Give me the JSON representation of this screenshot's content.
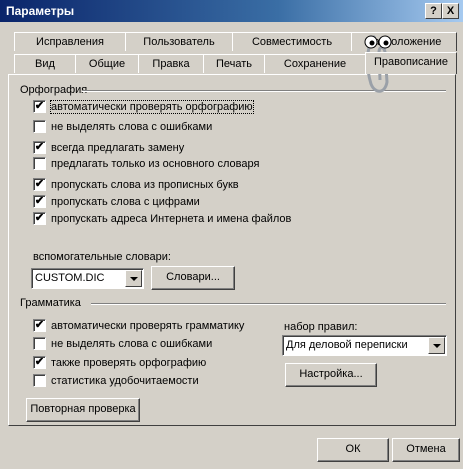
{
  "window": {
    "title": "Параметры",
    "help_label": "?",
    "close_label": "X"
  },
  "tabs_back": [
    "Исправления",
    "Пользователь",
    "Совместимость",
    "Расположение"
  ],
  "tabs_front": [
    "Вид",
    "Общие",
    "Правка",
    "Печать",
    "Сохранение",
    "Правописание"
  ],
  "spelling": {
    "header": "Орфография",
    "options": [
      {
        "label": "автоматически проверять орфографию",
        "checked": true,
        "focused": true
      },
      {
        "label": "не выделять слова с ошибками",
        "checked": false
      },
      {
        "label": "всегда предлагать замену",
        "checked": true
      },
      {
        "label": "предлагать только из основного словаря",
        "checked": false
      },
      {
        "label": "пропускать слова из прописных букв",
        "checked": true
      },
      {
        "label": "пропускать слова с цифрами",
        "checked": true
      },
      {
        "label": "пропускать адреса Интернета и имена файлов",
        "checked": true
      }
    ],
    "dicts_label": "вспомогательные словари:",
    "dict_value": "CUSTOM.DIC",
    "dicts_button": "Словари..."
  },
  "grammar": {
    "header": "Грамматика",
    "options": [
      {
        "label": "автоматически проверять грамматику",
        "checked": true
      },
      {
        "label": "не выделять слова с ошибками",
        "checked": false
      },
      {
        "label": "также проверять орфографию",
        "checked": true
      },
      {
        "label": "статистика удобочитаемости",
        "checked": false
      }
    ],
    "rules_label": "набор правил:",
    "rules_value": "Для деловой переписки",
    "settings_button": "Настройка...",
    "recheck_button": "Повторная проверка"
  },
  "footer": {
    "ok_label": "ОК",
    "cancel_label": "Отмена"
  },
  "colors": {
    "face": "#d4d0c8",
    "title_start": "#0a246a",
    "title_end": "#a6caf0"
  }
}
